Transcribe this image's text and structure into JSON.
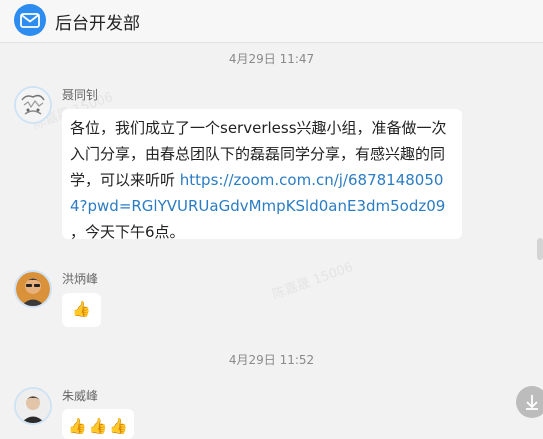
{
  "header": {
    "title": "后台开发部",
    "icon": "mail-icon"
  },
  "watermark": {
    "text": "陈嘉晟 15006"
  },
  "messages": [
    {
      "timestamp": "4月29日 11:47"
    },
    {
      "sender": "聂同钊",
      "text_before": "各位，我们成立了一个serverless兴趣小组，准备做一次入门分享，由春总团队下的磊磊同学分享，有感兴趣的同学，可以来听听 ",
      "link": "https://zoom.com.cn/j/68781480504?pwd=RGlYVURUaGdvMmpKSld0anE3dm5odz09",
      "text_after": "  ，今天下午6点。"
    },
    {
      "sender": "洪炳峰",
      "emoji": "👍"
    },
    {
      "timestamp": "4月29日 11:52"
    },
    {
      "sender": "朱威峰",
      "emoji": "👍👍👍"
    }
  ],
  "colors": {
    "accent": "#2d8cf0",
    "link": "#2b7cc4"
  }
}
